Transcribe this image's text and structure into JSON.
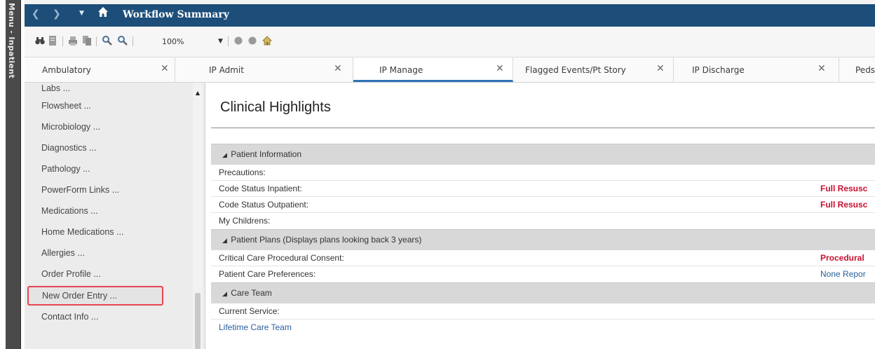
{
  "left_strip": {
    "label": "Menu - Inpatient"
  },
  "titlebar": {
    "title": "Workflow Summary"
  },
  "toolbar": {
    "zoom": "100%"
  },
  "tabs": [
    {
      "label": "Ambulatory"
    },
    {
      "label": "IP Admit"
    },
    {
      "label": "IP Manage"
    },
    {
      "label": "Flagged Events/Pt Story"
    },
    {
      "label": "IP Discharge"
    },
    {
      "label": "Peds"
    }
  ],
  "sidebar": {
    "items": [
      {
        "label": "Labs ..."
      },
      {
        "label": "Flowsheet ..."
      },
      {
        "label": "Microbiology ..."
      },
      {
        "label": "Diagnostics ..."
      },
      {
        "label": "Pathology ..."
      },
      {
        "label": "PowerForm Links ..."
      },
      {
        "label": "Medications ..."
      },
      {
        "label": "Home Medications ..."
      },
      {
        "label": "Allergies ..."
      },
      {
        "label": "Order Profile ..."
      },
      {
        "label": "New Order Entry ..."
      },
      {
        "label": "Contact Info ..."
      }
    ]
  },
  "main": {
    "title": "Clinical Highlights",
    "sections": [
      {
        "header": "Patient Information",
        "rows": [
          {
            "label": "Precautions:",
            "value": ""
          },
          {
            "label": "Code Status Inpatient:",
            "value": "Full Resusc"
          },
          {
            "label": "Code Status Outpatient:",
            "value": "Full Resusc"
          },
          {
            "label": "My Childrens:",
            "value": ""
          }
        ]
      },
      {
        "header": "Patient Plans (Displays plans looking back 3 years)",
        "rows": [
          {
            "label": "Critical Care Procedural Consent:",
            "value": "Procedural"
          },
          {
            "label": "Patient Care Preferences:",
            "value": "None Repor"
          }
        ]
      },
      {
        "header": "Care Team",
        "rows": [
          {
            "label": "Current Service:",
            "value": ""
          },
          {
            "label": "Lifetime Care Team",
            "value": ""
          }
        ]
      }
    ]
  },
  "colors": {
    "titlebar": "#1d4e7a",
    "active_tab_underline": "#2e72b6",
    "alert_value": "#c8102e",
    "link": "#2b5f9e",
    "highlight_box": "#e54553"
  }
}
